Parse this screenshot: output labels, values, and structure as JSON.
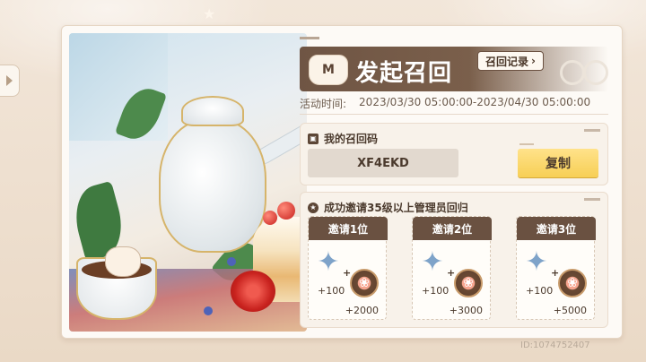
{
  "header": {
    "title": "发起召回",
    "record_button": "召回记录",
    "record_chevron": "›",
    "mascot_text": "M"
  },
  "event": {
    "label": "活动时间:",
    "range": "2023/03/30 05:00:00-2023/04/30 05:00:00"
  },
  "recall_code": {
    "heading": "我的召回码",
    "code": "XF4EKD",
    "copy_button": "复制"
  },
  "invite": {
    "heading": "成功邀请35级以上管理员回归",
    "rewards": [
      {
        "label": "邀请1位",
        "item1_amount": "+100",
        "plus": "+",
        "item2_amount": "+2000"
      },
      {
        "label": "邀请2位",
        "item1_amount": "+100",
        "plus": "+",
        "item2_amount": "+3000"
      },
      {
        "label": "邀请3位",
        "item1_amount": "+100",
        "plus": "+",
        "item2_amount": "+5000"
      }
    ]
  },
  "footer": {
    "uid": "ID:1074752407"
  },
  "icons": {
    "side_tab": "triangle-right-icon",
    "code_heading": "id-card-icon",
    "invite_heading": "star-badge-icon",
    "reward_item1": "crystal-star-icon",
    "reward_item2": "paw-coin-icon"
  },
  "colors": {
    "banner": "#6f5544",
    "copy_button": "#f7cf55",
    "panel": "#fdfaf6",
    "reward_head": "#6a5141"
  }
}
